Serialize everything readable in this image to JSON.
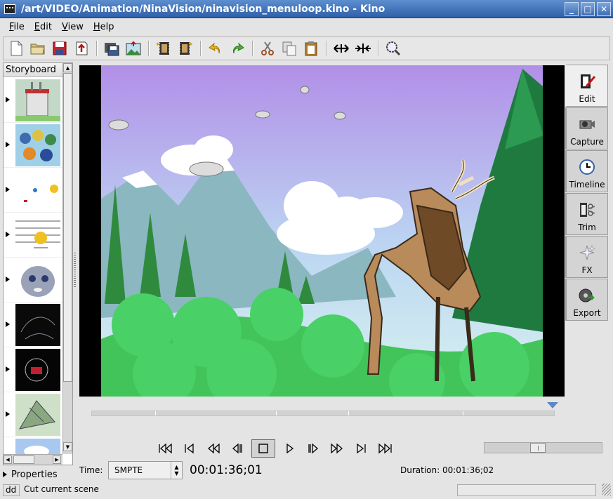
{
  "window": {
    "title": "/art/VIDEO/Animation/NinaVision/ninavision_menuloop.kino - Kino",
    "controls": [
      "minimize-icon",
      "maximize-icon",
      "close-icon"
    ]
  },
  "menubar": {
    "items": [
      {
        "label": "File",
        "mnemonic": "F",
        "rest": "ile"
      },
      {
        "label": "Edit",
        "mnemonic": "E",
        "rest": "dit"
      },
      {
        "label": "View",
        "mnemonic": "V",
        "rest": "iew"
      },
      {
        "label": "Help",
        "mnemonic": "H",
        "rest": "elp"
      }
    ]
  },
  "toolbar": {
    "groups": [
      [
        "new-document-icon",
        "open-folder-icon",
        "save-icon",
        "export-icon"
      ],
      [
        "save-still-icon",
        "export-image-icon"
      ],
      [
        "insert-before-icon",
        "insert-after-icon"
      ],
      [
        "undo-icon",
        "redo-icon"
      ],
      [
        "cut-icon",
        "copy-icon",
        "paste-icon"
      ],
      [
        "split-scene-icon",
        "join-scene-icon"
      ],
      [
        "zoom-icon"
      ]
    ]
  },
  "storyboard": {
    "header": "Storyboard",
    "scene_count": 9
  },
  "properties": {
    "label": "Properties"
  },
  "transport": {
    "buttons": [
      "first-scene-icon",
      "previous-scene-icon",
      "rewind-icon",
      "step-back-icon",
      "stop-icon",
      "play-icon",
      "step-forward-icon",
      "fast-forward-icon",
      "next-scene-icon",
      "last-scene-icon"
    ]
  },
  "time": {
    "label": "Time:",
    "format": "SMPTE",
    "current": "00:01:36;01",
    "duration_text": "Duration: 00:01:36;02"
  },
  "volume": {
    "level": 0.45
  },
  "sidetabs": [
    {
      "label": "Edit",
      "icon": "edit-film-icon",
      "active": true
    },
    {
      "label": "Capture",
      "icon": "camera-icon",
      "active": false
    },
    {
      "label": "Timeline",
      "icon": "clock-icon",
      "active": false
    },
    {
      "label": "Trim",
      "icon": "trim-icon",
      "active": false
    },
    {
      "label": "FX",
      "icon": "fx-sparkle-icon",
      "active": false
    },
    {
      "label": "Export",
      "icon": "export-film-icon",
      "active": false
    }
  ],
  "statusbar": {
    "mode": "dd",
    "message": "Cut current scene"
  },
  "colors": {
    "titlebar": "#3f6fb7",
    "sky": "#b49ae6",
    "grass": "#3fc05a",
    "scrubber_head": "#5b87c4"
  }
}
